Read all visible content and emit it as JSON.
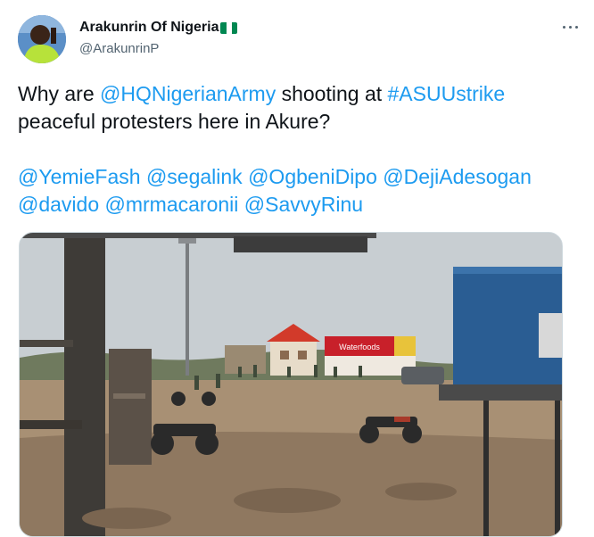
{
  "tweet": {
    "author": {
      "display_name": "Arakunrin Of Nigeria",
      "flag_emoji": "nigeria-flag",
      "handle": "@ArakunrinP"
    },
    "more_icon": "more-horizontal-icon",
    "text": {
      "line1_prefix": "Why are ",
      "mention_army": "@HQNigerianArmy",
      "line1_mid": " shooting at ",
      "hashtag": "#ASUUstrike",
      "line2": "peaceful protesters here in Akure?",
      "mentions": [
        "@YemieFash",
        "@segalink",
        "@OgbeniDipo",
        "@DejiAdesogan",
        "@davido",
        "@mrmacaronii",
        "@SavvyRinu"
      ]
    },
    "media": {
      "type": "video-still",
      "signboard_text": "Waterfoods"
    }
  },
  "colors": {
    "link": "#1d9bf0",
    "text": "#0f1419",
    "secondary": "#536471",
    "flag_green": "#008751"
  }
}
